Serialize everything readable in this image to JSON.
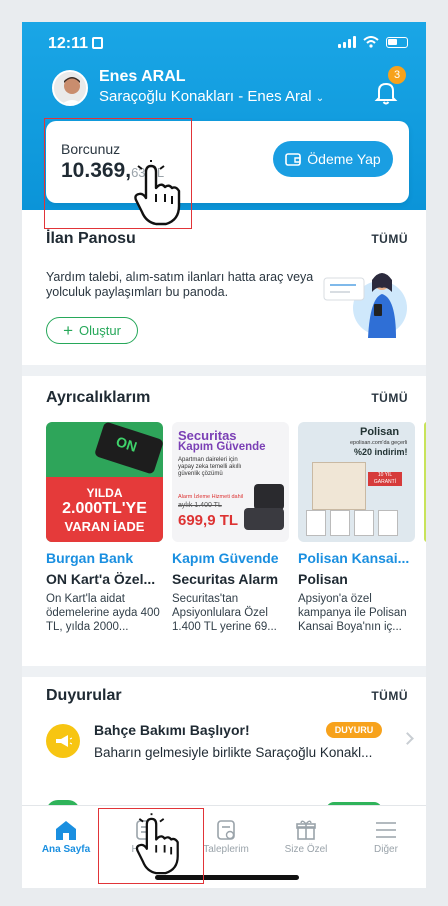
{
  "status_bar": {
    "time": "12:11"
  },
  "user": {
    "name": "Enes ARAL",
    "site": "Saraçoğlu Konakları - Enes Aral"
  },
  "notifications": {
    "count": "3"
  },
  "debt": {
    "label": "Borcunuz",
    "amount": "10.369,",
    "amount_tail": "63 TL",
    "pay_label": "Ödeme Yap"
  },
  "ilan": {
    "title": "İlan Panosu",
    "all_label": "TÜMÜ",
    "description": "Yardım talebi, alım-satım ilanları hatta araç veya yolculuk paylaşımları bu panoda.",
    "create_label": "Oluştur"
  },
  "perks": {
    "title": "Ayrıcalıklarım",
    "all_label": "TÜMÜ",
    "items": [
      {
        "brand": "Burgan Bank",
        "title": "ON Kart'a Özel...",
        "description": "On Kart'la aidat ödemelerine ayda 400 TL, yılda 2000...",
        "image_text": {
          "line1": "YILDA",
          "line2": "2.000TL'YE",
          "line3": "VARAN İADE",
          "card": "ON"
        }
      },
      {
        "brand": "Kapım Güvende",
        "title": "Securitas Alarm",
        "description": "Securitas'tan Apsiyonlulara Özel 1.400 TL yerine 69...",
        "image_text": {
          "head1": "Securitas",
          "head2": "Kapım Güvende",
          "sub": "Apartman daireleri için yapay zeka temelli akıllı güvenlik çözümü",
          "note": "Alarm İzleme Hizmeti dahil",
          "old": "aylık 1.400 TL",
          "price": "699,9 TL"
        }
      },
      {
        "brand": "Polisan Kansai...",
        "title": "Polisan",
        "description": "Apsiyon'a özel kampanya ile Polisan Kansai Boya'nın iç...",
        "image_text": {
          "logo": "Polisan",
          "line1": "epolisan.com'da geçerli",
          "line2": "%20 indirim!",
          "tag": "10 YIL GARANTİ"
        }
      }
    ]
  },
  "announcements": {
    "title": "Duyurular",
    "all_label": "TÜMÜ",
    "items": [
      {
        "title": "Bahçe Bakımı Başlıyor!",
        "badge": "DUYURU",
        "body": "Baharın gelmesiyle birlikte Saraçoğlu Konakl..."
      }
    ]
  },
  "tabbar": {
    "items": [
      {
        "label": "Ana Sayfa",
        "icon": "home-icon",
        "active": true
      },
      {
        "label": "Hesap",
        "icon": "account-icon",
        "active": false
      },
      {
        "label": "Taleplerim",
        "icon": "requests-icon",
        "active": false
      },
      {
        "label": "Size Özel",
        "icon": "gift-icon",
        "active": false
      },
      {
        "label": "Diğer",
        "icon": "menu-icon",
        "active": false
      }
    ]
  },
  "colors": {
    "brand_blue": "#1a9ee2",
    "accent_green": "#27a85a",
    "badge_orange": "#f7a21c",
    "highlight_red": "#e13438"
  }
}
